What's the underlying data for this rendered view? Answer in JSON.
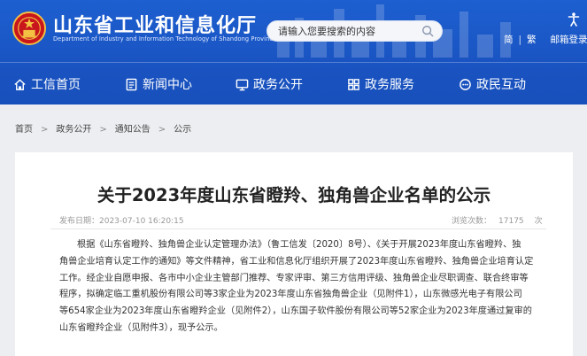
{
  "header": {
    "site_title": "山东省工业和信息化厅",
    "site_subtitle": "Department of Industry and Information Technology of Shandong Province",
    "search_placeholder": "请输入您要搜索的内容",
    "top_links": {
      "simplified": "简",
      "traditional": "繁",
      "mail": "邮箱登录"
    },
    "brand_color": "#1a56c4"
  },
  "nav": {
    "items": [
      {
        "label": "工信首页",
        "icon": "home-icon"
      },
      {
        "label": "新闻中心",
        "icon": "document-icon"
      },
      {
        "label": "政务公开",
        "icon": "monitor-icon"
      },
      {
        "label": "政务服务",
        "icon": "grid-icon"
      },
      {
        "label": "政民互动",
        "icon": "chat-icon"
      }
    ]
  },
  "breadcrumb": [
    "首页",
    "政务公开",
    "通知公告",
    "公示"
  ],
  "article": {
    "title": "关于2023年度山东省瞪羚、独角兽企业名单的公示",
    "publish_date": "发布日期：2023-07-10 16:20:15",
    "views_label": "浏览次数：",
    "views_count": "17175",
    "views_unit": "次",
    "body_lines": [
      "根据《山东省瞪羚、独角兽企业认定管理办法》（鲁工信发〔2020〕8号）、《关于开展2023年度山东省瞪羚、独",
      "角兽企业培育认定工作的通知》等文件精神，省工业和信息化厅组织开展了2023年度山东省瞪羚、独角兽企业培育认定",
      "工作。经企业自愿申报、各市中小企业主管部门推荐、专家评审、第三方信用评级、独角兽企业尽职调查、联合终审等",
      "程序，拟确定临工重机股份有限公司等3家企业为2023年度山东省独角兽企业（见附件1），山东微感光电子有限公司",
      "等654家企业为2023年度山东省瞪羚企业（见附件2），山东国子软件股份有限公司等52家企业为2023年度通过复审的",
      "山东省瞪羚企业（见附件3），现予公示。"
    ]
  }
}
